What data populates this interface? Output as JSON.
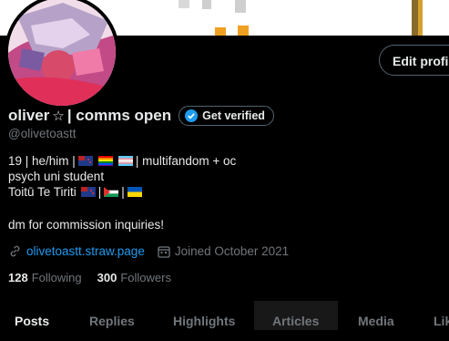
{
  "profile": {
    "display_name": "oliver",
    "name_star": "☆",
    "name_suffix": "| comms open",
    "verify_label": "Get verified",
    "handle": "@olivetoastt",
    "edit_label": "Edit profile",
    "bio": {
      "line1_prefix": "19 | he/him |",
      "line1_suffix": "| multifandom + oc",
      "line2": "psych uni student",
      "line3_prefix": "Toitū Te Tiriti",
      "line3_sep1": "|",
      "line3_sep2": "|"
    },
    "dm_line": "dm for commission inquiries!",
    "link": "olivetoastt.straw.page",
    "joined": "Joined October 2021",
    "following_count": "128",
    "following_label": "Following",
    "followers_count": "300",
    "followers_label": "Followers"
  },
  "tabs": [
    "Posts",
    "Replies",
    "Highlights",
    "Articles",
    "Media",
    "Likes"
  ],
  "colors": {
    "accent": "#1d9bf0",
    "muted": "#71767b",
    "text": "#e7e9ea",
    "border": "#536471"
  },
  "icons": [
    "verified-badge-icon",
    "link-icon",
    "calendar-icon"
  ]
}
